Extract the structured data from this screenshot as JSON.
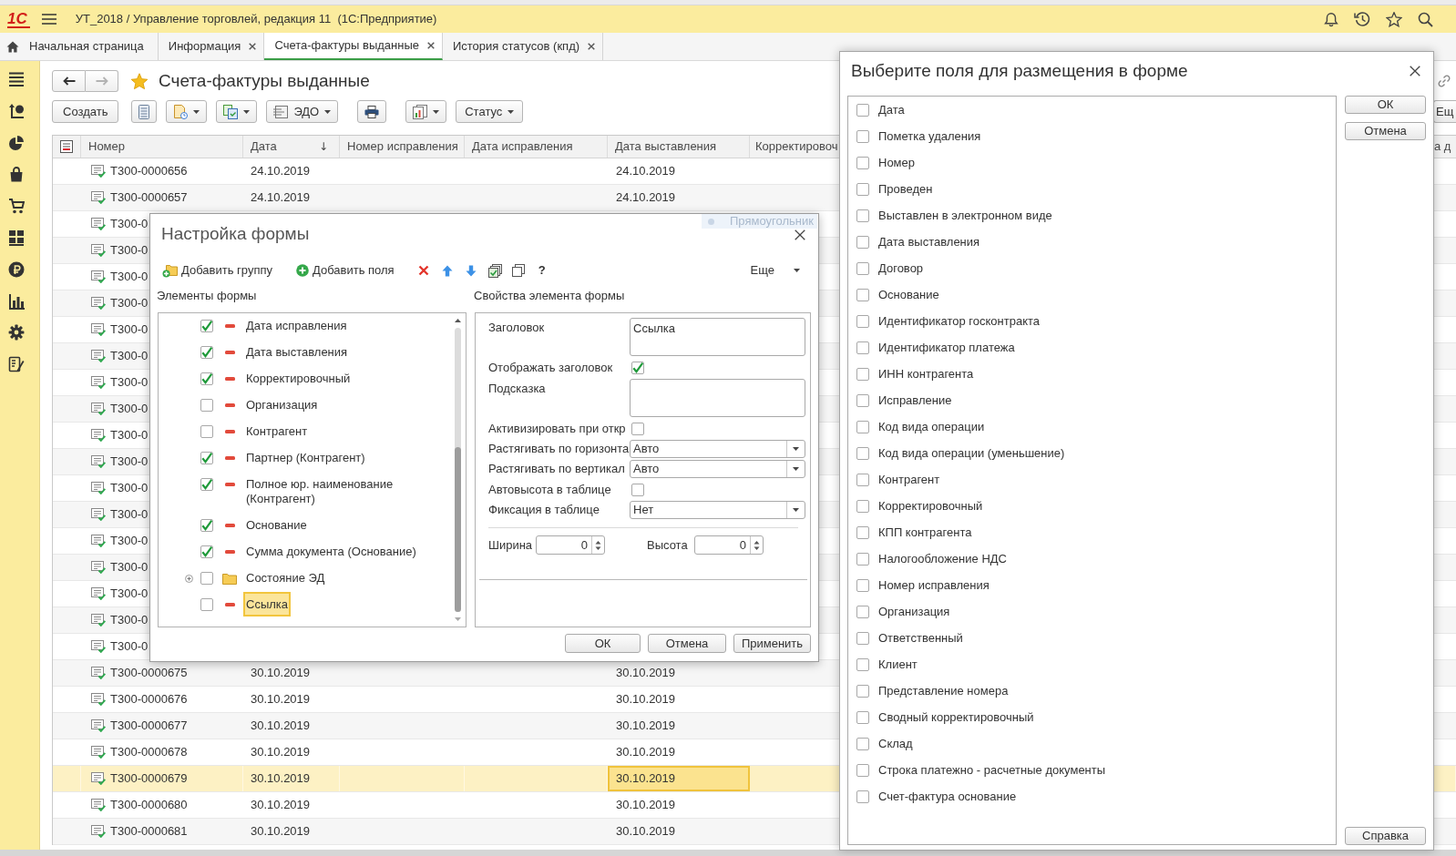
{
  "app_bar": {
    "logo": "1С",
    "title": "УТ_2018 / Управление торговлей, редакция 11  (1С:Предприятие)"
  },
  "tabs": [
    {
      "kind": "home",
      "label": "Начальная страница",
      "closable": false,
      "selected": false
    },
    {
      "kind": "page",
      "label": "Информация",
      "closable": true,
      "selected": false
    },
    {
      "kind": "page",
      "label": "Счета-фактуры выданные",
      "closable": true,
      "selected": true
    },
    {
      "kind": "page",
      "label": "История статусов (кпд)",
      "closable": true,
      "selected": false
    }
  ],
  "history_nav": [
    {
      "kind": "back",
      "disabled": false
    },
    {
      "kind": "forward",
      "disabled": true
    }
  ],
  "page": {
    "title": "Счета-фактуры выданные",
    "favorite": true
  },
  "toolbar": {
    "buttons": [
      {
        "kind": "create",
        "label": "Создать",
        "dropdown": false
      },
      {
        "kind": "list",
        "dropdown": false
      },
      {
        "kind": "document",
        "dropdown": true
      },
      {
        "kind": "documents",
        "dropdown": true
      },
      {
        "kind": "edo",
        "label": "ЭДО",
        "dropdown": true
      },
      {
        "kind": "print",
        "dropdown": false
      },
      {
        "kind": "report",
        "dropdown": true
      },
      {
        "kind": "status",
        "label": "Статус",
        "dropdown": true
      }
    ],
    "more": {
      "label": "Ещ"
    }
  },
  "table": {
    "columns": [
      {
        "label": "Номер"
      },
      {
        "label": "Дата",
        "sort_arrow": "↓"
      },
      {
        "label": "Номер исправления"
      },
      {
        "label": "Дата исправления"
      },
      {
        "label": "Дата выставления"
      },
      {
        "label": "Корректировоч"
      },
      {
        "label": "а д"
      }
    ],
    "rows": [
      {
        "number": "Т300-0000656",
        "date": "24.10.2019",
        "issued": "24.10.2019",
        "selected": false,
        "issued_focused": false
      },
      {
        "number": "Т300-0000657",
        "date": "24.10.2019",
        "issued": "24.10.2019",
        "selected": false,
        "issued_focused": false
      },
      {
        "number": "Т300-0",
        "selected": false
      },
      {
        "number": "Т300-0",
        "selected": false
      },
      {
        "number": "Т300-0",
        "selected": false
      },
      {
        "number": "Т300-0",
        "selected": false
      },
      {
        "number": "Т300-0",
        "selected": false
      },
      {
        "number": "Т300-0",
        "selected": false
      },
      {
        "number": "Т300-0",
        "selected": false
      },
      {
        "number": "Т300-0",
        "selected": false
      },
      {
        "number": "Т300-0",
        "selected": false
      },
      {
        "number": "Т300-0",
        "selected": false
      },
      {
        "number": "Т300-0",
        "selected": false
      },
      {
        "number": "Т300-0",
        "selected": false
      },
      {
        "number": "Т300-0",
        "selected": false
      },
      {
        "number": "Т300-0",
        "selected": false
      },
      {
        "number": "Т300-0",
        "selected": false
      },
      {
        "number": "Т300-0",
        "selected": false
      },
      {
        "number": "Т300-0",
        "selected": false
      },
      {
        "number": "Т300-0000675",
        "date": "30.10.2019",
        "issued": "30.10.2019",
        "selected": false,
        "issued_focused": false
      },
      {
        "number": "Т300-0000676",
        "date": "30.10.2019",
        "issued": "30.10.2019",
        "selected": false,
        "issued_focused": false
      },
      {
        "number": "Т300-0000677",
        "date": "30.10.2019",
        "issued": "30.10.2019",
        "selected": false,
        "issued_focused": false
      },
      {
        "number": "Т300-0000678",
        "date": "30.10.2019",
        "issued": "30.10.2019",
        "selected": false,
        "issued_focused": false
      },
      {
        "number": "Т300-0000679",
        "date": "30.10.2019",
        "issued": "30.10.2019",
        "selected": true,
        "issued_focused": true
      },
      {
        "number": "Т300-0000680",
        "date": "30.10.2019",
        "issued": "30.10.2019",
        "selected": false,
        "issued_focused": false
      },
      {
        "number": "Т300-0000681",
        "date": "30.10.2019",
        "issued": "30.10.2019",
        "selected": false,
        "issued_focused": false
      }
    ]
  },
  "tooltip": {
    "text": "Прямоугольник"
  },
  "form_settings": {
    "title": "Настройка формы",
    "toolbar": [
      {
        "kind": "add-group",
        "label": "Добавить группу"
      },
      {
        "kind": "add-fields",
        "label": "Добавить поля"
      },
      {
        "kind": "delete"
      },
      {
        "kind": "move-up"
      },
      {
        "kind": "move-down"
      },
      {
        "kind": "check-all"
      },
      {
        "kind": "copy"
      },
      {
        "kind": "help",
        "label": "?"
      }
    ],
    "more": {
      "label": "Еще"
    },
    "elements_label": "Элементы формы",
    "properties_label": "Свойства элемента формы",
    "tree": [
      {
        "kind": "field",
        "label": "Дата исправления",
        "checked": true,
        "selected": false
      },
      {
        "kind": "field",
        "label": "Дата выставления",
        "checked": true,
        "selected": false
      },
      {
        "kind": "field",
        "label": "Корректировочный",
        "checked": true,
        "selected": false
      },
      {
        "kind": "field",
        "label": "Организация",
        "checked": false,
        "selected": false
      },
      {
        "kind": "field",
        "label": "Контрагент",
        "checked": false,
        "selected": false
      },
      {
        "kind": "field",
        "label": "Партнер (Контрагент)",
        "checked": true,
        "selected": false
      },
      {
        "kind": "field",
        "label": "Полное юр. наименование (Контрагент)",
        "checked": true,
        "selected": false
      },
      {
        "kind": "field",
        "label": "Основание",
        "checked": true,
        "selected": false
      },
      {
        "kind": "field",
        "label": "Сумма документа (Основание)",
        "checked": true,
        "selected": false
      },
      {
        "kind": "group",
        "label": "Состояние ЭД",
        "checked": false,
        "selected": false,
        "expanded": false
      },
      {
        "kind": "field",
        "label": "Ссылка",
        "checked": false,
        "selected": true
      }
    ],
    "properties": {
      "rows": [
        {
          "kind": "text",
          "label": "Заголовок",
          "value": "Ссылка"
        },
        {
          "kind": "checkbox",
          "label": "Отображать заголовок",
          "checked": true
        },
        {
          "kind": "text",
          "label": "Подсказка"
        },
        {
          "kind": "checkbox",
          "label": "Активизировать при откр",
          "checked": false
        },
        {
          "kind": "select",
          "label": "Растягивать по горизонта",
          "value": "Авто"
        },
        {
          "kind": "select",
          "label": "Растягивать по вертикал",
          "value": "Авто"
        },
        {
          "kind": "checkbox",
          "label": "Автовысота в таблице",
          "checked": false
        },
        {
          "kind": "select",
          "label": "Фиксация в таблице",
          "value": "Нет"
        }
      ],
      "width": {
        "label": "Ширина",
        "value": "0"
      },
      "height": {
        "label": "Высота",
        "value": "0"
      }
    },
    "buttons": [
      {
        "label": "ОК"
      },
      {
        "label": "Отмена"
      },
      {
        "label": "Применить"
      }
    ]
  },
  "field_picker": {
    "title": "Выберите поля для размещения в форме",
    "fields": [
      {
        "label": "Дата",
        "checked": false
      },
      {
        "label": "Пометка удаления",
        "checked": false
      },
      {
        "label": "Номер",
        "checked": false
      },
      {
        "label": "Проведен",
        "checked": false
      },
      {
        "label": "Выставлен в электронном виде",
        "checked": false
      },
      {
        "label": "Дата выставления",
        "checked": false
      },
      {
        "label": "Договор",
        "checked": false
      },
      {
        "label": "Основание",
        "checked": false
      },
      {
        "label": "Идентификатор госконтракта",
        "checked": false
      },
      {
        "label": "Идентификатор платежа",
        "checked": false
      },
      {
        "label": "ИНН контрагента",
        "checked": false
      },
      {
        "label": "Исправление",
        "checked": false
      },
      {
        "label": "Код вида операции",
        "checked": false
      },
      {
        "label": "Код вида операции (уменьшение)",
        "checked": false
      },
      {
        "label": "Контрагент",
        "checked": false
      },
      {
        "label": "Корректировочный",
        "checked": false
      },
      {
        "label": "КПП контрагента",
        "checked": false
      },
      {
        "label": "Налогообложение НДС",
        "checked": false
      },
      {
        "label": "Номер исправления",
        "checked": false
      },
      {
        "label": "Организация",
        "checked": false
      },
      {
        "label": "Ответственный",
        "checked": false
      },
      {
        "label": "Клиент",
        "checked": false
      },
      {
        "label": "Представление номера",
        "checked": false
      },
      {
        "label": "Сводный корректировочный",
        "checked": false
      },
      {
        "label": "Склад",
        "checked": false
      },
      {
        "label": "Строка платежно - расчетные документы",
        "checked": false
      },
      {
        "label": "Счет-фактура основание",
        "checked": false
      }
    ],
    "buttons": [
      {
        "label": "ОК"
      },
      {
        "label": "Отмена"
      }
    ],
    "help": {
      "label": "Справка"
    }
  }
}
